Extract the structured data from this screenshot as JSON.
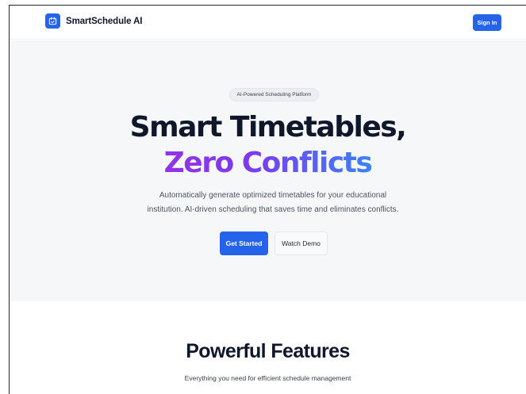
{
  "header": {
    "brand": "SmartSchedule AI",
    "logo_icon": "calendar-icon",
    "signin_label": "Sign In"
  },
  "hero": {
    "badge": "AI-Powered Scheduling Platform",
    "title_line1": "Smart Timetables,",
    "title_line2": "Zero Conflicts",
    "subtitle_line1": "Automatically generate optimized timetables for your educational",
    "subtitle_line2": "institution. AI-driven scheduling that saves time and eliminates conflicts.",
    "primary_cta": "Get Started",
    "secondary_cta": "Watch Demo"
  },
  "features": {
    "title": "Powerful Features",
    "subtitle": "Everything you need for efficient schedule management"
  },
  "colors": {
    "primary": "#2563eb",
    "gradient_start": "#9333ea",
    "gradient_end": "#3b82f6",
    "hero_bg": "#f6f7f9"
  }
}
